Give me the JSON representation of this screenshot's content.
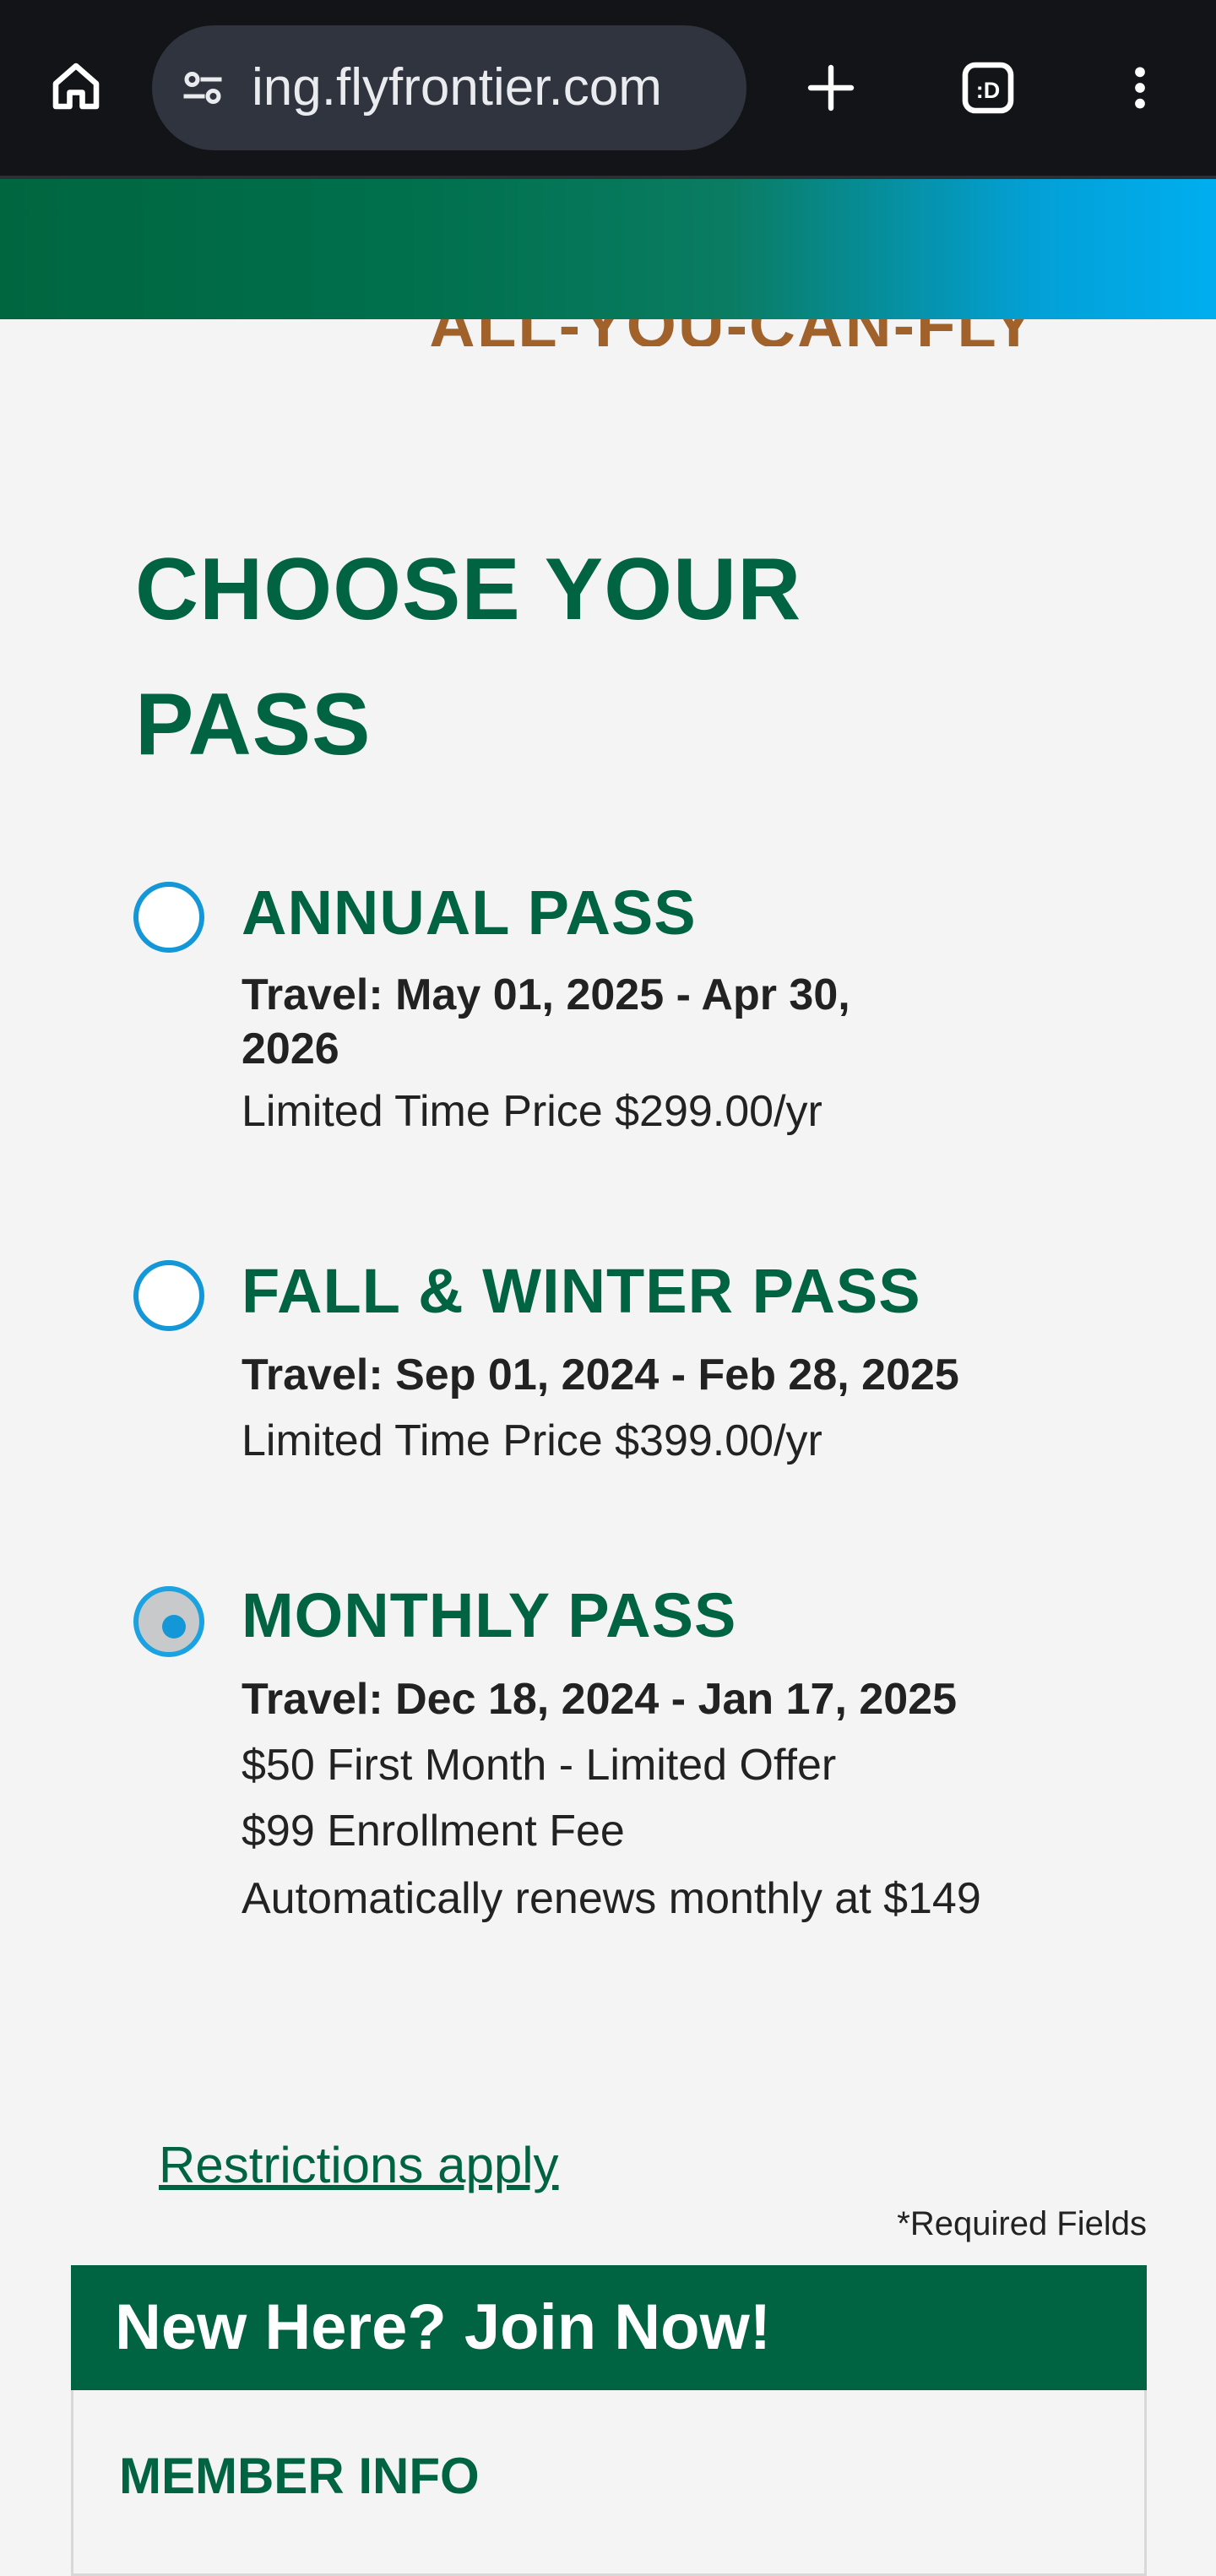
{
  "browser": {
    "url_text": "ing.flyfrontier.com",
    "icons": [
      "home-icon",
      "site-settings-icon",
      "new-tab-icon",
      "tab-switcher-icon",
      "more-menu-icon"
    ],
    "tab_count_label": ":D"
  },
  "header": {
    "promo_text": "ALL-YOU-CAN-FLY"
  },
  "page": {
    "title_line1": "CHOOSE YOUR",
    "title_line2": "PASS"
  },
  "passes": [
    {
      "name": "ANNUAL PASS",
      "travel": "Travel: May 01, 2025 - Apr 30, 2026",
      "lines": [
        "Limited Time Price $299.00/yr"
      ],
      "selected": false
    },
    {
      "name": "FALL & WINTER PASS",
      "travel": "Travel: Sep 01, 2024 - Feb 28, 2025",
      "lines": [
        "Limited Time Price $399.00/yr"
      ],
      "selected": false
    },
    {
      "name": "MONTHLY PASS",
      "travel": "Travel: Dec 18, 2024 - Jan 17, 2025",
      "lines": [
        "$50 First Month - Limited Offer",
        "$99 Enrollment Fee",
        "Automatically renews monthly at $149"
      ],
      "selected": true
    }
  ],
  "links": {
    "restrictions": "Restrictions apply"
  },
  "form": {
    "required_note": "*Required Fields",
    "join_title": "New Here? Join Now!",
    "member_section": "MEMBER INFO"
  },
  "colors": {
    "brand_green": "#006341",
    "radio_blue": "#1497d6",
    "promo_brown": "#a0612a"
  }
}
